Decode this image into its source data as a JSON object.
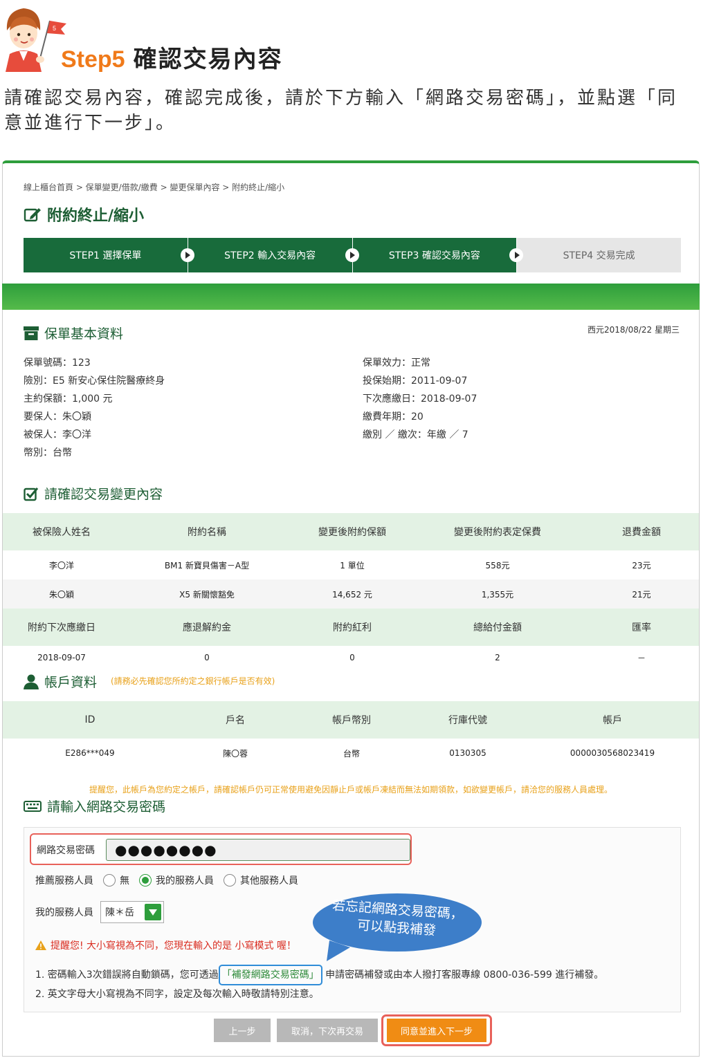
{
  "tutorial": {
    "step_label": "Step5",
    "step_title": "確認交易內容",
    "description": "請確認交易內容，確認完成後，請於下方輸入「網路交易密碼」，並點選「同意並進行下一步」。",
    "mascot_flag": "5"
  },
  "breadcrumb": "線上櫃台首頁 > 保單變更/借款/繳費 > 變更保單內容 > 附約終止/縮小",
  "page_title": "附約終止/縮小",
  "steps": [
    {
      "label": "STEP1 選擇保單",
      "active": true
    },
    {
      "label": "STEP2 輸入交易內容",
      "active": true
    },
    {
      "label": "STEP3 確認交易內容",
      "active": true
    },
    {
      "label": "STEP4 交易完成",
      "active": false
    }
  ],
  "policy_section": {
    "title": "保單基本資料",
    "date": "西元2018/08/22 星期三",
    "left": [
      "保單號碼：123",
      "險別：E5 新安心保住院醫療終身",
      "主約保額：1,000 元",
      "要保人：朱〇穎",
      "被保人：李〇洋",
      "幣別：台幣"
    ],
    "right": [
      "保單效力：正常",
      "投保始期：2011-09-07",
      "下次應繳日：2018-09-07",
      "繳費年期：20",
      "繳別 ／ 繳次：年繳 ／ 7"
    ]
  },
  "change_section": {
    "title": "請確認交易變更內容",
    "headers": [
      "被保險人姓名",
      "附約名稱",
      "變更後附約保額",
      "變更後附約表定保費",
      "退費金額"
    ],
    "rows": [
      [
        "李〇洋",
        "BM1 新寶貝傷害－A型",
        "1 單位",
        "558元",
        "23元"
      ],
      [
        "朱〇穎",
        "X5 新關懷豁免",
        "14,652 元",
        "1,355元",
        "21元"
      ]
    ],
    "headers2": [
      "附約下次應繳日",
      "應退解約金",
      "附約紅利",
      "總給付金額",
      "匯率"
    ],
    "rows2": [
      [
        "2018-09-07",
        "0",
        "0",
        "2",
        "－"
      ]
    ]
  },
  "account_section": {
    "title": "帳戶資料",
    "note": "(請務必先確認您所約定之銀行帳戶是否有效)",
    "headers": [
      "ID",
      "戶名",
      "帳戶幣別",
      "行庫代號",
      "帳戶"
    ],
    "rows": [
      [
        "E286***049",
        "陳〇蓉",
        "台幣",
        "0130305",
        "0000030568023419"
      ]
    ],
    "warning": "提醒您，此帳戶為您約定之帳戶，請確認帳戶仍可正常使用避免因靜止戶或帳戶凍結而無法如期領款，如欲變更帳戶，請洽您的服務人員處理。"
  },
  "password_section": {
    "title": "請輸入網路交易密碼",
    "password_label": "網路交易密碼",
    "password_value": "●●●●●●●●",
    "referral_label": "推薦服務人員",
    "referral_options": [
      "無",
      "我的服務人員",
      "其他服務人員"
    ],
    "referral_selected": 1,
    "my_agent_label": "我的服務人員",
    "my_agent_value": "陳＊岳",
    "caps_warning": "提醒您! 大小寫視為不同，您現在輸入的是 小寫模式 喔！",
    "note1_prefix": "1. 密碼輸入3次錯誤將自動鎖碼，您可透過",
    "note1_link": "「補發網路交易密碼」",
    "note1_suffix": "申請密碼補發或由本人撥打客服專線 0800-036-599 進行補發。",
    "note2": "2. 英文字母大小寫視為不同字，設定及每次輸入時敬請特別注意。"
  },
  "callout": {
    "line1": "若忘記網路交易密碼，",
    "line2": "可以點我補發"
  },
  "buttons": {
    "prev": "上一步",
    "cancel": "取消，下次再交易",
    "next": "同意並進入下一步"
  },
  "colors": {
    "brand_green": "#186b3b",
    "accent_orange": "#f07a1a",
    "highlight_red": "#e8615a",
    "warning_amber": "#e8a11a",
    "callout_blue": "#3d7ec9"
  }
}
